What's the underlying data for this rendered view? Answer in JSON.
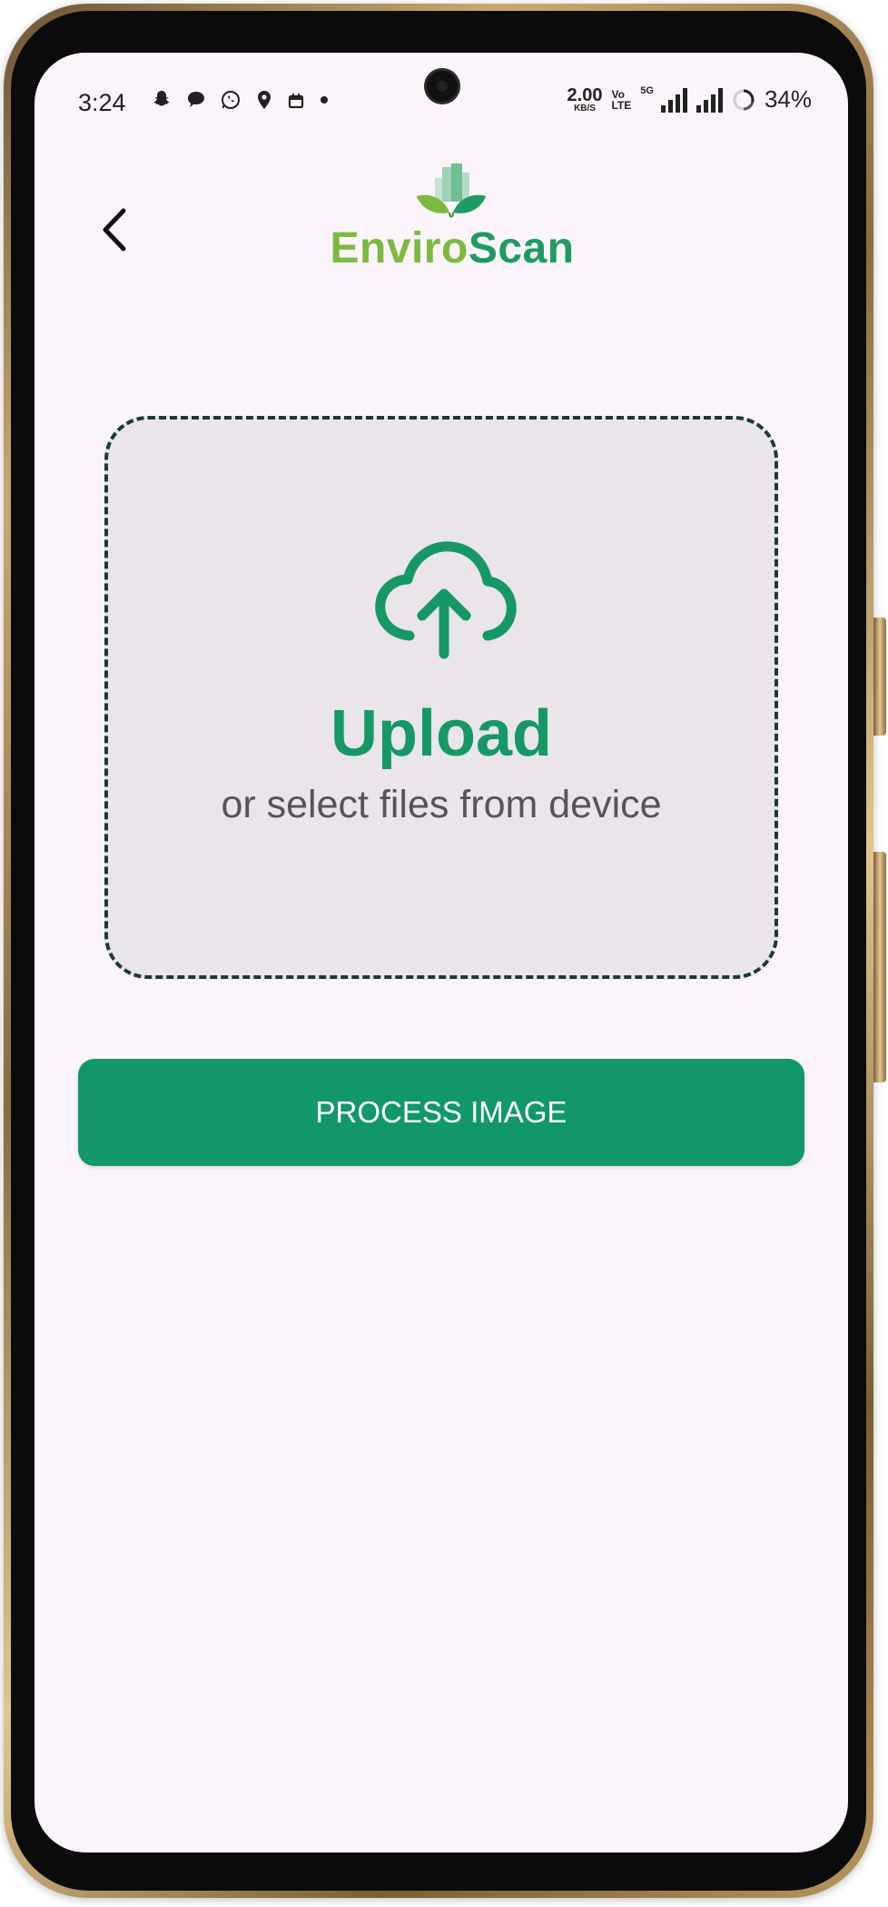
{
  "status_bar": {
    "time": "3:24",
    "notification_icons": [
      "snapchat-icon",
      "chat-bubble-icon",
      "whatsapp-icon",
      "location-icon",
      "calendar-icon",
      "dot-icon"
    ],
    "network_speed_value": "2.00",
    "network_speed_unit": "KB/S",
    "volte_top": "Vo",
    "volte_bottom": "LTE",
    "network_type": "5G",
    "battery_percent": "34%"
  },
  "header": {
    "back_icon": "chevron-left-icon",
    "logo_part1": "Enviro",
    "logo_part2": "Scan"
  },
  "upload": {
    "icon": "cloud-upload-icon",
    "title": "Upload",
    "subtitle": "or select files from device"
  },
  "actions": {
    "process_label": "PROCESS IMAGE"
  },
  "colors": {
    "accent_green": "#12976a",
    "logo_light_green": "#7cba3f",
    "logo_dark_green": "#1d9b63",
    "screen_background": "#fbf4fb",
    "dropzone_background": "#e9e5ea"
  }
}
